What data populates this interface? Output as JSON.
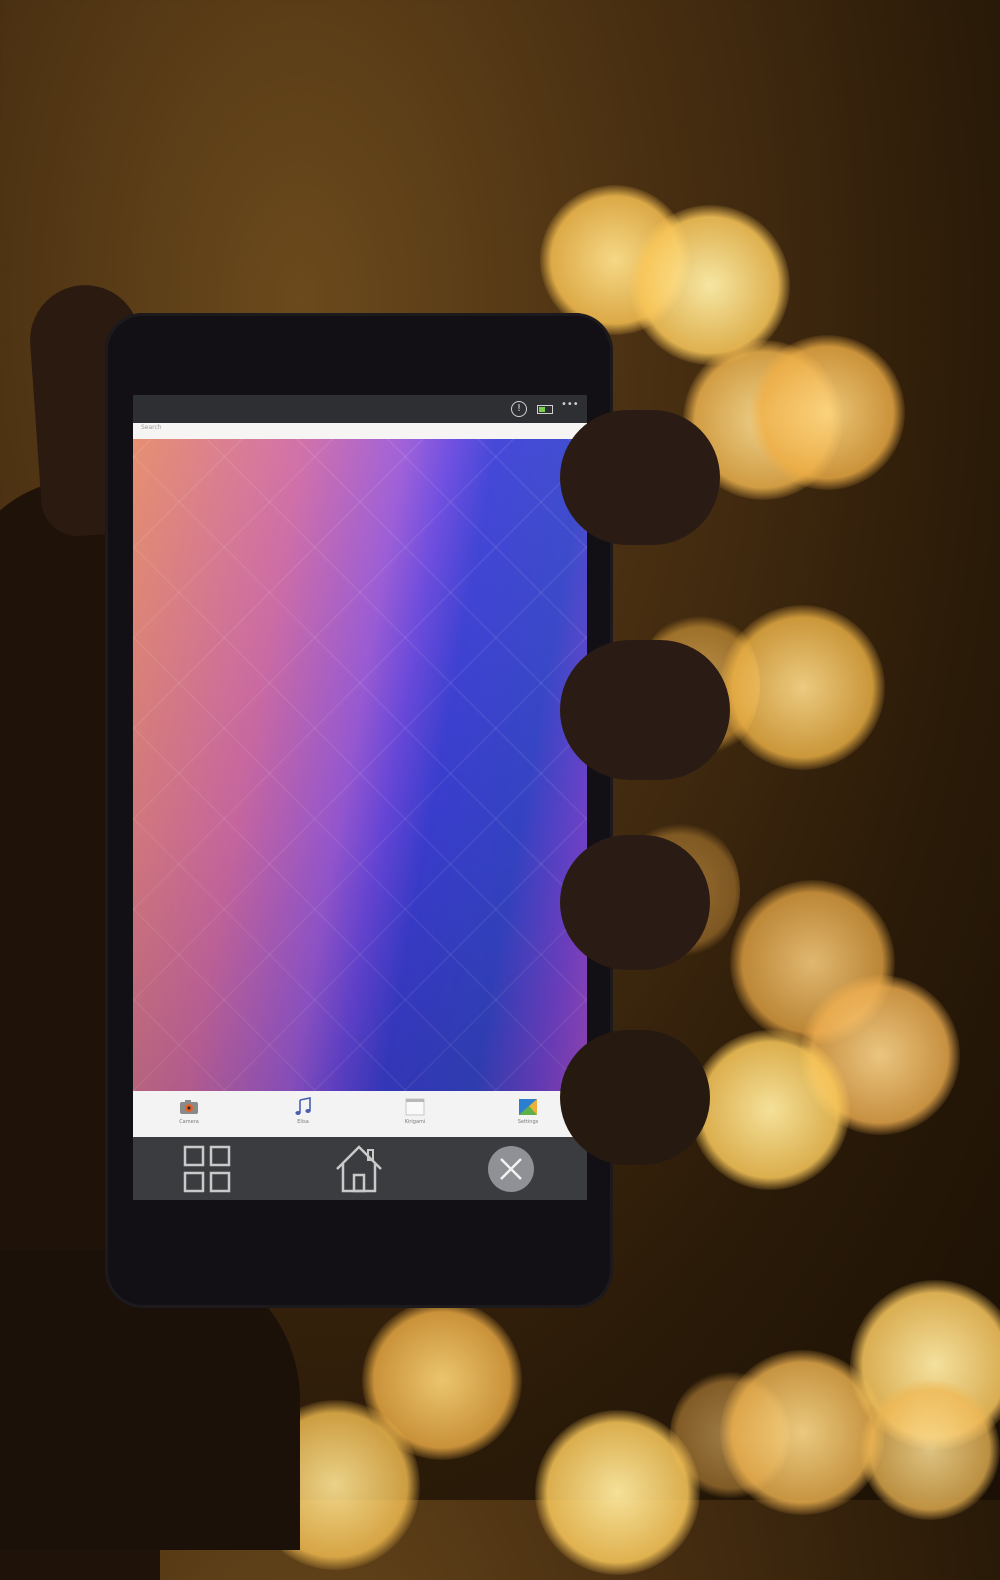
{
  "scene": {
    "background": "bokeh-lights",
    "light_color": "#f5c86a",
    "hand_color": "#24160d"
  },
  "phone": {
    "status_bar": {
      "alert_glyph": "!",
      "more_glyph": "•••"
    },
    "search_placeholder": "Search",
    "dock": [
      {
        "label": "Camera",
        "icon": "camera-icon"
      },
      {
        "label": "Elisa",
        "icon": "music-note-icon"
      },
      {
        "label": "Kirigami",
        "icon": "app-window-icon"
      },
      {
        "label": "Settings",
        "icon": "settings-icon"
      }
    ],
    "navbar": {
      "left_icon": "grid-icon",
      "center_icon": "home-icon",
      "right_icon": "close-icon"
    }
  }
}
